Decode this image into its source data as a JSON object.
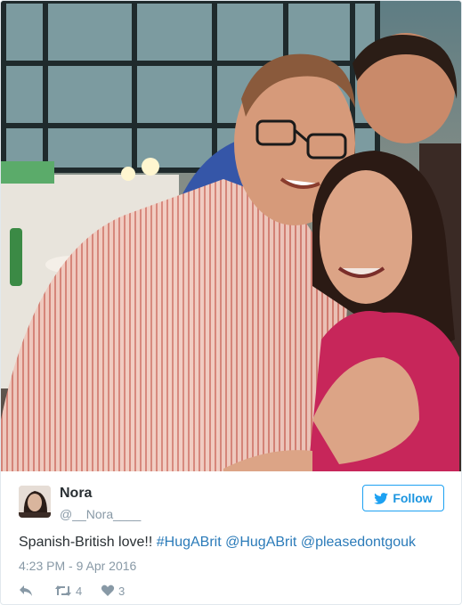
{
  "photo": {
    "alt_icon": "photo"
  },
  "tweet": {
    "name": "Nora",
    "handle": "@__Nora____",
    "follow_label": "Follow",
    "text_plain": "Spanish-British love!! ",
    "hashtag": "#HugABrit",
    "mention1": "@HugABrit",
    "mention2": "@pleasedontgouk",
    "timestamp": "4:23 PM - 9 Apr 2016",
    "retweets": "4",
    "likes": "3"
  },
  "colors": {
    "link": "#2b7bb9",
    "follow_border": "#1da1f2",
    "muted": "#8899a6",
    "text": "#292f33"
  }
}
